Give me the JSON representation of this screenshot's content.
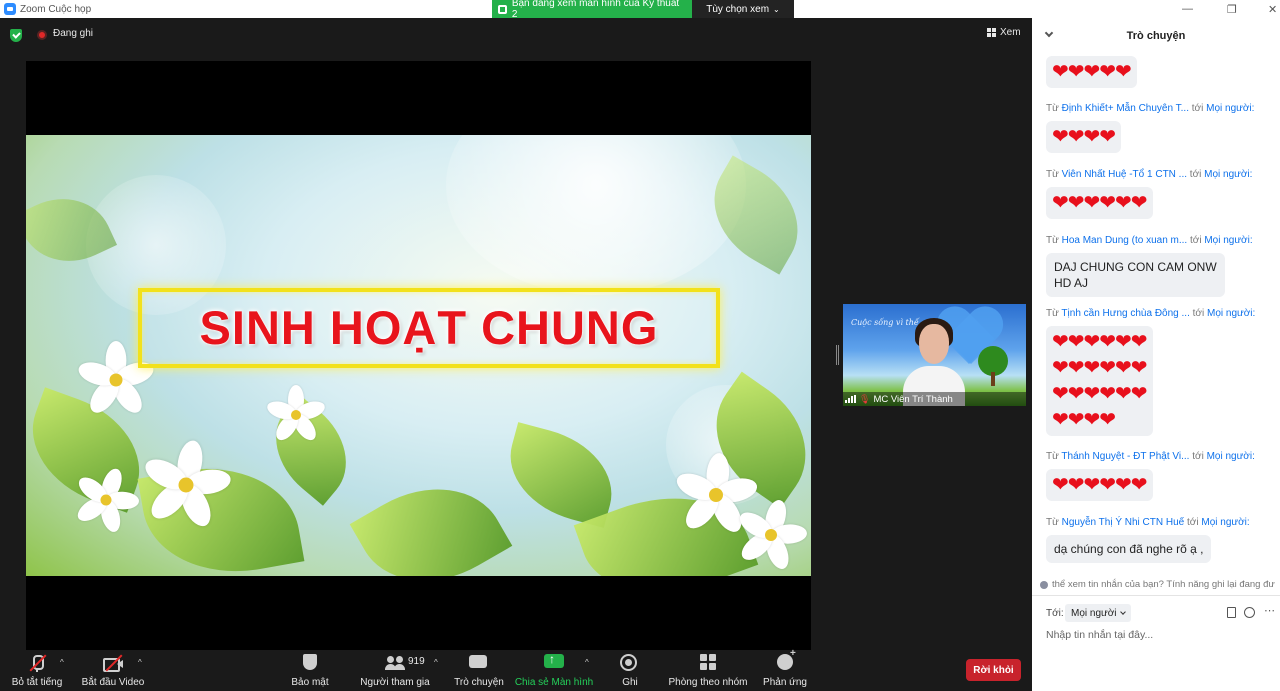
{
  "window": {
    "title": "Zoom Cuộc họp",
    "share_banner": "Bạn đang xem màn hình của Ky thuat 2",
    "view_options": "Tùy chọn xem"
  },
  "topbar": {
    "recording": "Đang ghi",
    "view": "Xem"
  },
  "slide": {
    "title": "SINH HOẠT CHUNG"
  },
  "video_tile": {
    "name": "MC Viên Trí Thành",
    "overlay_script": "Cuộc sống vì thế"
  },
  "toolbar": {
    "mute": "Bỏ tắt tiếng",
    "video": "Bắt đầu Video",
    "security": "Bảo mật",
    "participants": "Người tham gia",
    "participant_count": "919",
    "chat": "Trò chuyện",
    "share": "Chia sẻ Màn hình",
    "record": "Ghi",
    "breakout": "Phòng theo nhóm",
    "reactions": "Phản ứng",
    "leave": "Rời khỏi"
  },
  "chat": {
    "title": "Trò chuyện",
    "messages": [
      {
        "from": "",
        "to": "",
        "text": "❤❤❤❤❤"
      },
      {
        "from": "Định Khiết+ Mẫn Chuyên T...",
        "to": "Mọi người:",
        "text": "❤❤❤❤"
      },
      {
        "from": "Viên Nhất Huệ -Tổ 1 CTN ...",
        "to": "Mọi người:",
        "text": "❤❤❤❤❤❤"
      },
      {
        "from": "Hoa Man Dung (to xuan m...",
        "to": "Mọi người:",
        "text_line1": "DAJ CHUNG CON CAM ONW",
        "text_line2": "HD AJ"
      },
      {
        "from": "Tịnh cần Hưng chùa Đông ...",
        "to": "Mọi người:",
        "line1": "❤❤❤❤❤❤",
        "line2": "❤❤❤❤❤❤",
        "line3": "❤❤❤❤❤❤",
        "line4": "❤❤❤❤"
      },
      {
        "from": "Thánh Nguyệt - ĐT Phật Vi...",
        "to": "Mọi người:",
        "text": "❤❤❤❤❤❤"
      },
      {
        "from": "Nguyễn Thị Ý Nhi CTN Huế",
        "to": "Mọi người:",
        "text": "dạ chúng con đã nghe rõ ạ ,"
      }
    ],
    "from_prefix": "Từ",
    "to_prefix": "tới",
    "notice": "thể xem tin nhắn của bạn? Tính năng ghi lại đang đư",
    "to_label": "Tới:",
    "to_value": "Mọi người",
    "input_placeholder": "Nhập tin nhắn tại đây..."
  }
}
